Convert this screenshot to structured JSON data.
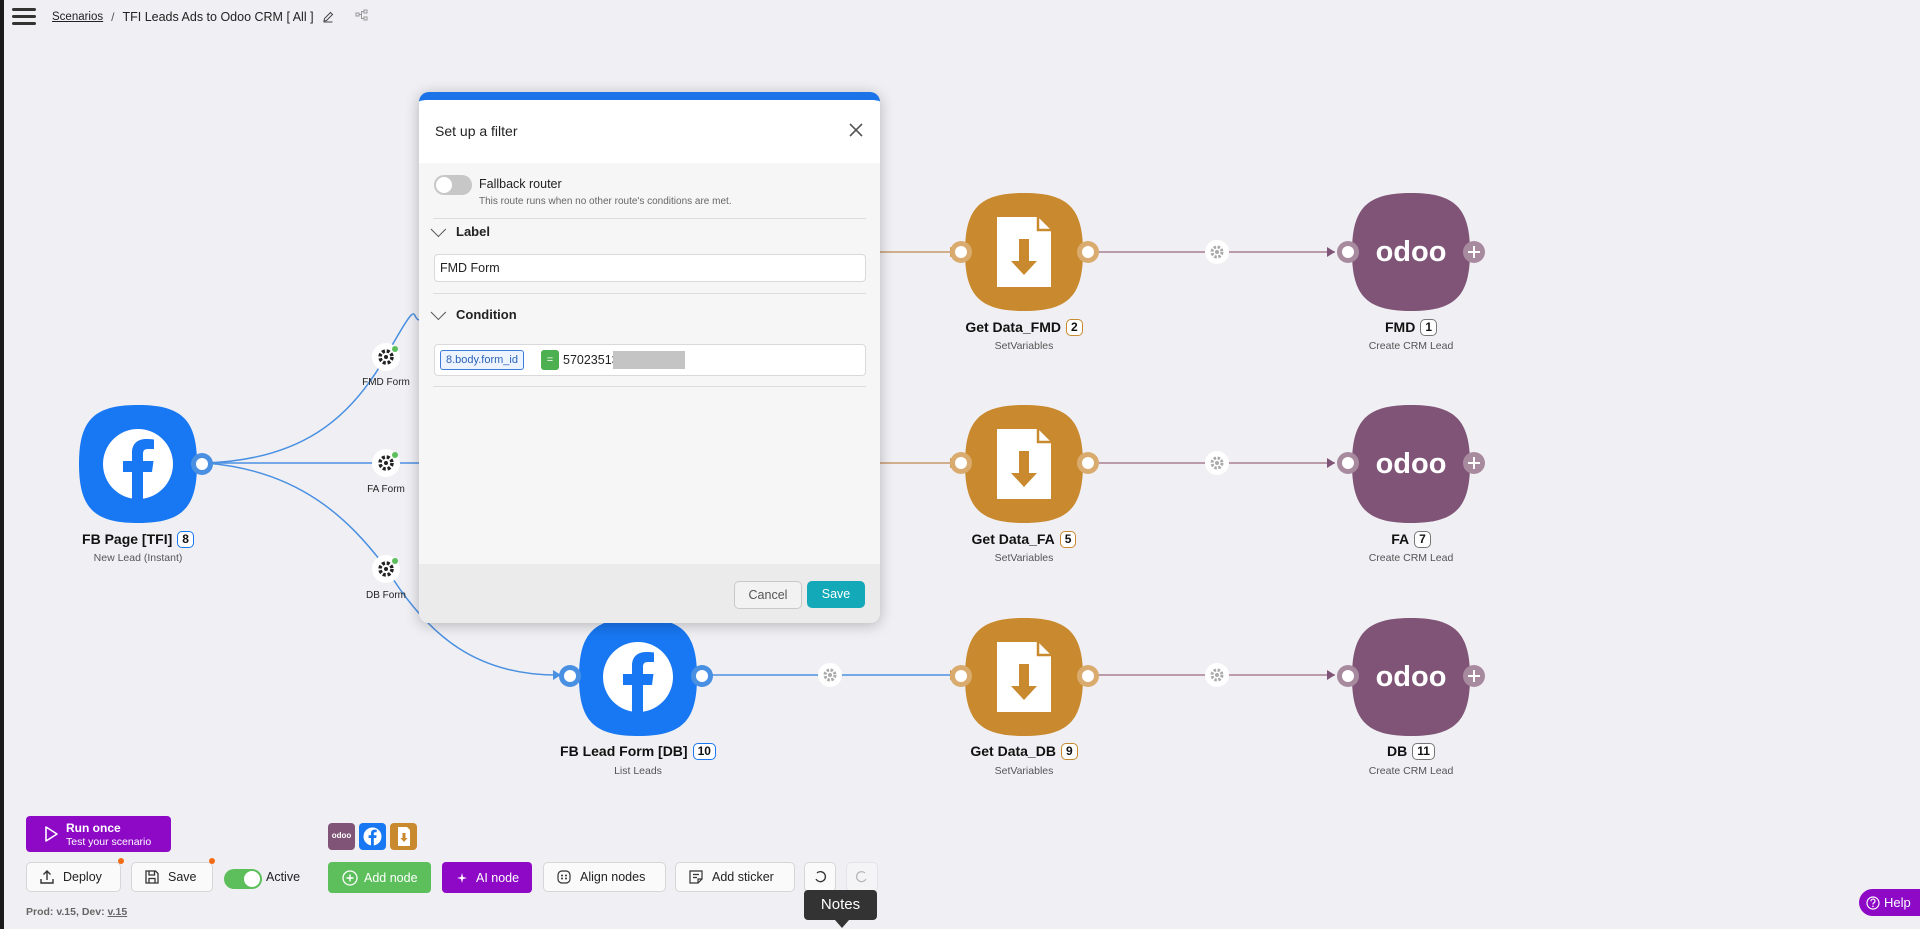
{
  "header": {
    "breadcrumb_root": "Scenarios",
    "separator": "/",
    "scenario_title": "TFI Leads Ads to Odoo CRM [ All ]"
  },
  "nodes": {
    "fb_page": {
      "name": "FB Page [TFI]",
      "id": "8",
      "subtitle": "New Lead (Instant)"
    },
    "fb_lead_form": {
      "name": "FB Lead Form [DB]",
      "id": "10",
      "subtitle": "List Leads"
    },
    "get_fmd": {
      "name": "Get Data_FMD",
      "id": "2",
      "subtitle": "SetVariables"
    },
    "get_fa": {
      "name": "Get Data_FA",
      "id": "5",
      "subtitle": "SetVariables"
    },
    "get_db": {
      "name": "Get Data_DB",
      "id": "9",
      "subtitle": "SetVariables"
    },
    "odoo_fmd": {
      "name": "FMD",
      "id": "1",
      "subtitle": "Create CRM Lead",
      "logo_text": "odoo"
    },
    "odoo_fa": {
      "name": "FA",
      "id": "7",
      "subtitle": "Create CRM Lead",
      "logo_text": "odoo"
    },
    "odoo_db": {
      "name": "DB",
      "id": "11",
      "subtitle": "Create CRM Lead",
      "logo_text": "odoo"
    }
  },
  "routers": {
    "fmd": "FMD Form",
    "fa": "FA Form",
    "db": "DB Form"
  },
  "filter_dialog": {
    "title": "Set up a filter",
    "fallback_label": "Fallback router",
    "fallback_description": "This route runs when no other route's conditions are met.",
    "fallback_enabled": false,
    "label_section": "Label",
    "label_value": "FMD Form",
    "condition_section": "Condition",
    "condition_variable": "8.body.form_id",
    "condition_operator": "=",
    "condition_value": "57023513",
    "cancel_label": "Cancel",
    "save_label": "Save"
  },
  "toolbar": {
    "run_once_title": "Run once",
    "run_once_subtitle": "Test your scenario",
    "deploy_label": "Deploy",
    "save_label": "Save",
    "active_label": "Active",
    "active_enabled": true,
    "add_node_label": "Add node",
    "ai_node_label": "AI node",
    "align_nodes_label": "Align nodes",
    "add_sticker_label": "Add sticker",
    "mini_odoo": "odoo",
    "version_prefix": "Prod: v.15, Dev: ",
    "version_dev": "v.15"
  },
  "tooltip": "Notes",
  "help_label": "Help",
  "colors": {
    "facebook": "#1877f2",
    "setvariables": "#c98a2f",
    "odoo": "#7f5476",
    "accent_purple": "#8e09c6",
    "accent_teal": "#13a9b8",
    "active_green": "#5cbf5b",
    "link_blue": "#4a90e2"
  },
  "icons": [
    "menu-icon",
    "edit-icon",
    "tree-icon",
    "close-icon",
    "gear-icon",
    "play-icon",
    "upload-icon",
    "save-icon",
    "plus-icon",
    "sparkle-icon",
    "align-icon",
    "sticker-icon",
    "undo-icon",
    "redo-icon",
    "help-icon"
  ]
}
